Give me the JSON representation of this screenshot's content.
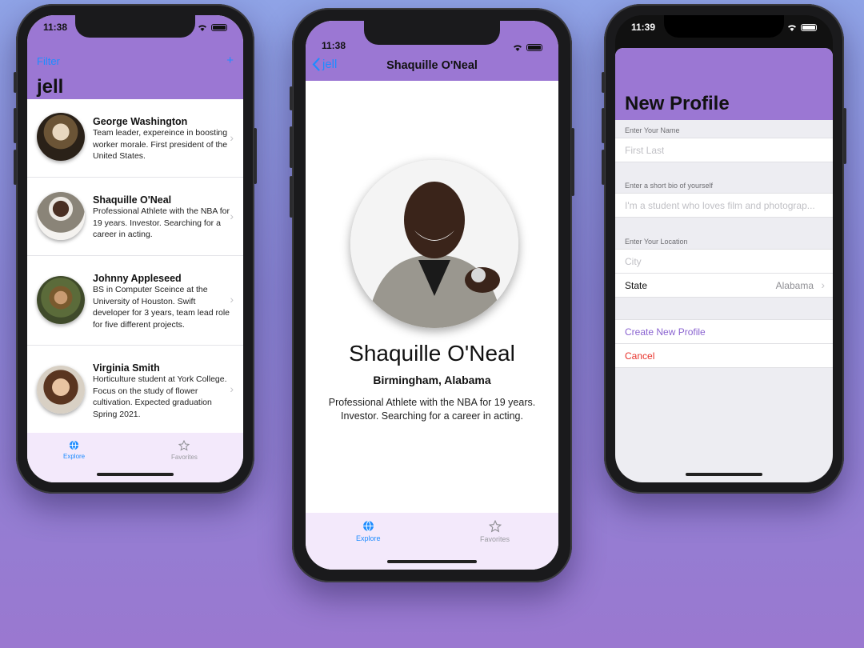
{
  "colors": {
    "accent": "#1e8cff",
    "header": "#9b77d3",
    "tabbar": "#f3e9fb",
    "destructive": "#e8322b",
    "action": "#8a63d0"
  },
  "phone1": {
    "time": "11:38",
    "filter_label": "Filter",
    "add_label": "+",
    "title": "jell",
    "rows": [
      {
        "name": "George Washington",
        "bio": "Team leader, expereince in boosting worker morale. First president of the United States."
      },
      {
        "name": "Shaquille O'Neal",
        "bio": "Professional Athlete with the NBA for 19 years. Investor. Searching for a career in acting."
      },
      {
        "name": "Johnny Appleseed",
        "bio": "BS in Computer Sceince at the University of Houston. Swift developer for 3 years, team lead role for five different projects."
      },
      {
        "name": "Virginia Smith",
        "bio": "Horticulture student at York College. Focus on the study of flower cultivation. Expected graduation Spring 2021."
      }
    ],
    "tabs": [
      {
        "label": "Explore",
        "icon": "globe-icon"
      },
      {
        "label": "Favorites",
        "icon": "star-icon"
      }
    ]
  },
  "phone2": {
    "time": "11:38",
    "back_label": "jell",
    "nav_title": "Shaquille O'Neal",
    "name": "Shaquille O'Neal",
    "location": "Birmingham,  Alabama",
    "bio": "Professional Athlete with the NBA for 19 years. Investor. Searching for a career in acting.",
    "tabs": [
      {
        "label": "Explore",
        "icon": "globe-icon"
      },
      {
        "label": "Favorites",
        "icon": "star-icon"
      }
    ]
  },
  "phone3": {
    "time": "11:39",
    "title": "New Profile",
    "name_header": "Enter Your Name",
    "name_placeholder": "First Last",
    "bio_header": "Enter a short bio of yourself",
    "bio_placeholder": "I'm a student who loves film and photograp...",
    "location_header": "Enter Your Location",
    "city_placeholder": "City",
    "state_label": "State",
    "state_value": "Alabama",
    "create_label": "Create New Profile",
    "cancel_label": "Cancel"
  }
}
